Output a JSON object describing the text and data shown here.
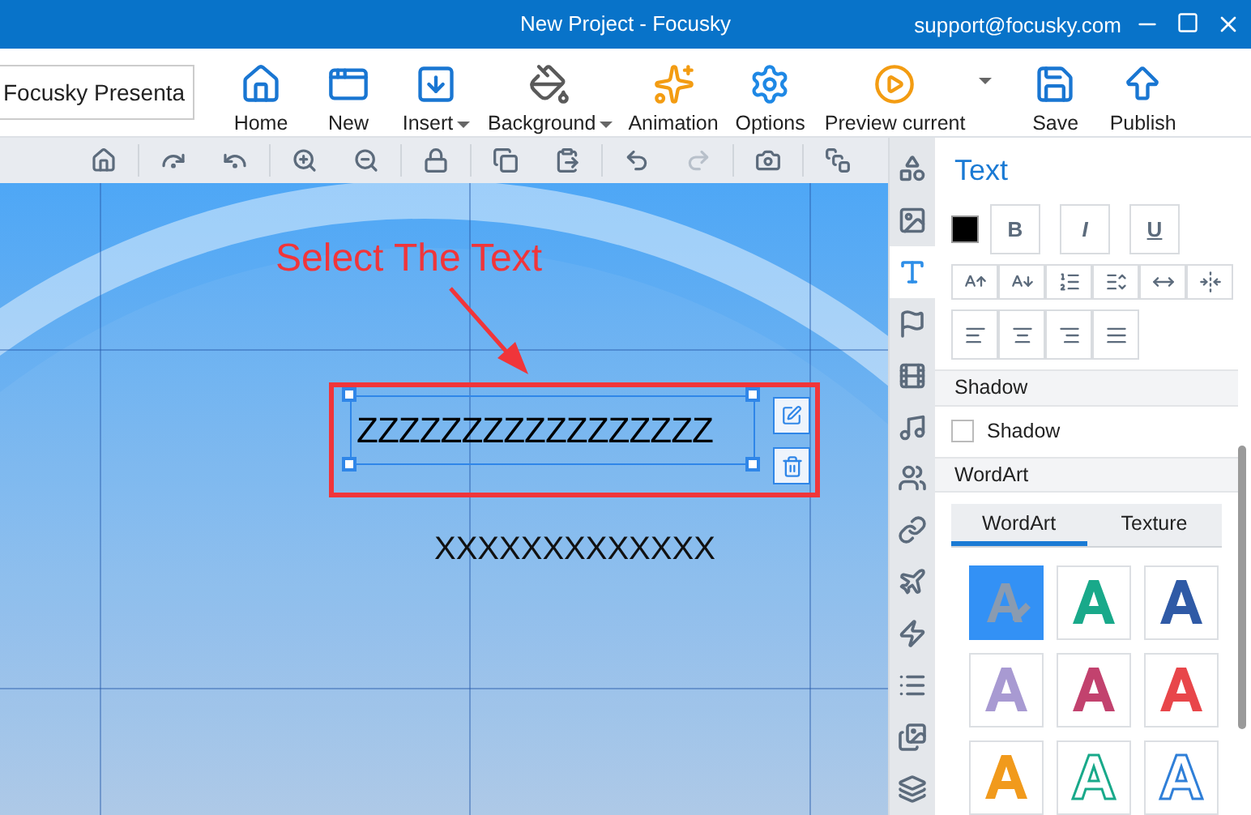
{
  "window": {
    "title": "New Project - Focusky",
    "support": "support@focusky.com"
  },
  "toolbar": {
    "project_name": "Focusky Presenta",
    "buttons": [
      {
        "kind": "home",
        "label": "Home",
        "dropdown": false
      },
      {
        "kind": "new",
        "label": "New",
        "dropdown": false
      },
      {
        "kind": "insert",
        "label": "Insert",
        "dropdown": true
      },
      {
        "kind": "background",
        "label": "Background",
        "dropdown": true
      },
      {
        "kind": "animation",
        "label": "Animation",
        "dropdown": false
      },
      {
        "kind": "options",
        "label": "Options",
        "dropdown": false
      },
      {
        "kind": "preview",
        "label": "Preview current",
        "dropdown": true
      },
      {
        "kind": "save",
        "label": "Save",
        "dropdown": false
      },
      {
        "kind": "publish",
        "label": "Publish",
        "dropdown": false
      }
    ]
  },
  "canvas_tools": [
    {
      "kind": "home",
      "disabled": false
    },
    {
      "kind": "rotate-right",
      "disabled": false
    },
    {
      "kind": "rotate-left",
      "disabled": false
    },
    {
      "kind": "zoom-in",
      "disabled": false
    },
    {
      "kind": "zoom-out",
      "disabled": false
    },
    {
      "kind": "lock",
      "disabled": false
    },
    {
      "kind": "copy",
      "disabled": false
    },
    {
      "kind": "paste",
      "disabled": false
    },
    {
      "kind": "undo",
      "disabled": false
    },
    {
      "kind": "redo",
      "disabled": true
    },
    {
      "kind": "camera",
      "disabled": false
    },
    {
      "kind": "frames",
      "disabled": false
    }
  ],
  "canvas": {
    "annotation": "Select The Text",
    "selected_text": "ZZZZZZZZZZZZZZZZZ",
    "other_text": "XXXXXXXXXXXXX"
  },
  "side_tabs": [
    {
      "kind": "shape",
      "selected": false
    },
    {
      "kind": "image",
      "selected": false
    },
    {
      "kind": "text",
      "selected": true
    },
    {
      "kind": "flag",
      "selected": false
    },
    {
      "kind": "video",
      "selected": false
    },
    {
      "kind": "music",
      "selected": false
    },
    {
      "kind": "people",
      "selected": false
    },
    {
      "kind": "link",
      "selected": false
    },
    {
      "kind": "plane",
      "selected": false
    },
    {
      "kind": "flash",
      "selected": false
    },
    {
      "kind": "list",
      "selected": false
    },
    {
      "kind": "gallery",
      "selected": false
    },
    {
      "kind": "layers",
      "selected": false
    }
  ],
  "panel": {
    "title": "Text",
    "style_buttons": [
      {
        "label": "B",
        "kind": "bold"
      },
      {
        "label": "I",
        "kind": "italic"
      },
      {
        "label": "U",
        "kind": "underline"
      }
    ],
    "size_buttons": [
      {
        "kind": "grow"
      },
      {
        "kind": "shrink"
      },
      {
        "kind": "numbered"
      },
      {
        "kind": "spacing"
      },
      {
        "kind": "expand"
      },
      {
        "kind": "condense"
      }
    ],
    "align_buttons": [
      {
        "kind": "left"
      },
      {
        "kind": "center"
      },
      {
        "kind": "right"
      },
      {
        "kind": "justify"
      }
    ],
    "shadow": {
      "title": "Shadow",
      "label": "Shadow",
      "checked": false
    },
    "wordart": {
      "title": "WordArt",
      "tabs": [
        {
          "label": "WordArt",
          "selected": true
        },
        {
          "label": "Texture",
          "selected": false
        }
      ],
      "styles": [
        {
          "kind": "none",
          "color": "#8a9bb0",
          "selected": true
        },
        {
          "kind": "solid",
          "color": "#19a98a",
          "selected": false
        },
        {
          "kind": "solid",
          "color": "#2f5aa6",
          "selected": false
        },
        {
          "kind": "solid",
          "color": "#a89ad2",
          "selected": false
        },
        {
          "kind": "solid",
          "color": "#c2426e",
          "selected": false
        },
        {
          "kind": "solid",
          "color": "#e8464a",
          "selected": false
        },
        {
          "kind": "solid",
          "color": "#f19a1c",
          "selected": false
        },
        {
          "kind": "outline",
          "color": "#19a98a",
          "selected": false
        },
        {
          "kind": "outline",
          "color": "#2f7fd8",
          "selected": false
        }
      ]
    }
  }
}
